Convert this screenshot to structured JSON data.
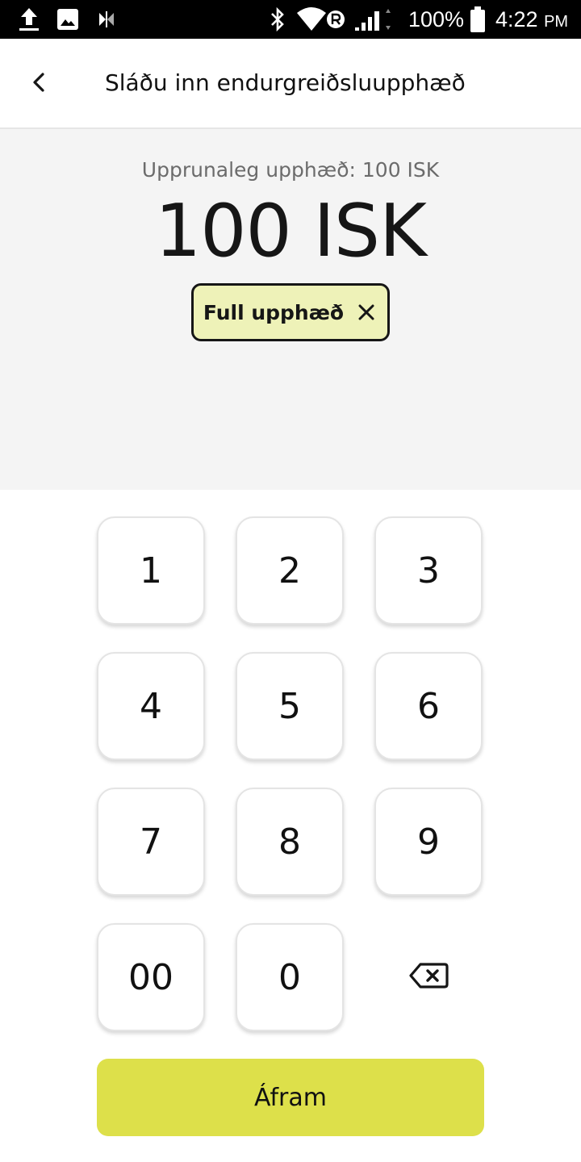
{
  "status_bar": {
    "battery": "100%",
    "time": "4:22",
    "ampm": "PM",
    "icons": [
      "upload-icon",
      "image-icon",
      "app-icon",
      "bluetooth-icon",
      "wifi-icon",
      "roaming-icon",
      "signal-icon",
      "battery-icon"
    ]
  },
  "header": {
    "title": "Sláðu inn endurgreiðsluupphæð",
    "back_icon": "chevron-left-icon"
  },
  "amount": {
    "original_label": "Upprunaleg upphæð: 100 ISK",
    "value": "100 ISK",
    "chip_label": "Full upphæð",
    "chip_icon": "close-icon"
  },
  "keypad": {
    "keys": [
      "1",
      "2",
      "3",
      "4",
      "5",
      "6",
      "7",
      "8",
      "9",
      "00",
      "0"
    ],
    "backspace_icon": "backspace-icon"
  },
  "footer": {
    "continue_label": "Áfram"
  },
  "colors": {
    "accent": "#dde04a",
    "chip_bg": "#eef2b8",
    "panel_bg": "#f4f4f4",
    "status_bar_bg": "#000000"
  }
}
